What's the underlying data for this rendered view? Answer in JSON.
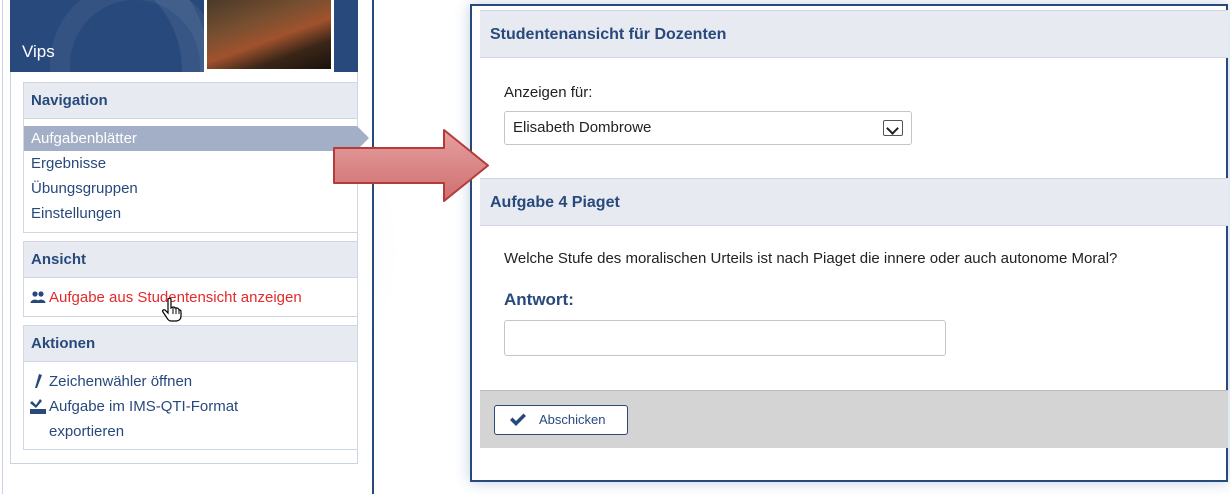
{
  "sidebar": {
    "app_title": "Vips",
    "navigation": {
      "title": "Navigation",
      "items": [
        {
          "label": "Aufgabenblätter",
          "active": true
        },
        {
          "label": "Ergebnisse"
        },
        {
          "label": "Übungsgruppen"
        },
        {
          "label": "Einstellungen"
        }
      ]
    },
    "view": {
      "title": "Ansicht",
      "student_view_link": "Aufgabe aus Studentensicht anzeigen",
      "icon": "users-icon"
    },
    "actions": {
      "title": "Aktionen",
      "items": [
        {
          "label": "Zeichenwähler öffnen",
          "icon": "pencil-icon"
        },
        {
          "label": "Aufgabe im IMS-QTI-Format",
          "icon": "export-icon"
        },
        {
          "label": "exportieren"
        }
      ]
    }
  },
  "panel": {
    "student_view_title": "Studentenansicht für Dozenten",
    "show_for_label": "Anzeigen für:",
    "show_for_value": "Elisabeth Dombrowe",
    "task_title": "Aufgabe 4 Piaget",
    "question": "Welche Stufe des moralischen Urteils ist nach Piaget die innere oder auch autonome Moral?",
    "answer_label": "Antwort:",
    "answer_value": "",
    "submit_label": "Abschicken"
  },
  "colors": {
    "brand": "#28497c",
    "link_red": "#e42a2a",
    "active_nav": "#a3afc7",
    "arrow": "#d98585"
  }
}
